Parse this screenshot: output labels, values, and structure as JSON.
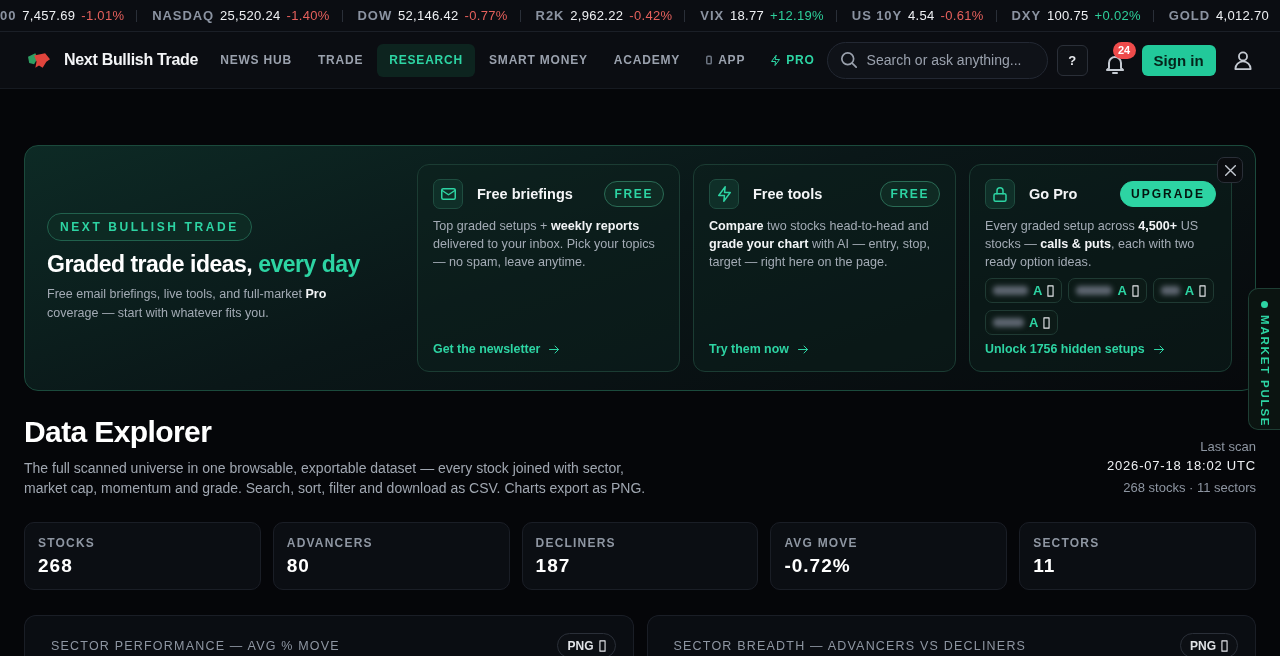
{
  "ticker": [
    {
      "label": "00",
      "value": "7,457.69",
      "change": "-1.01%",
      "positive": false
    },
    {
      "label": "NASDAQ",
      "value": "25,520.24",
      "change": "-1.40%",
      "positive": false
    },
    {
      "label": "DOW",
      "value": "52,146.42",
      "change": "-0.77%",
      "positive": false
    },
    {
      "label": "R2K",
      "value": "2,962.22",
      "change": "-0.42%",
      "positive": false
    },
    {
      "label": "VIX",
      "value": "18.77",
      "change": "+12.19%",
      "positive": true
    },
    {
      "label": "US 10Y",
      "value": "4.54",
      "change": "-0.61%",
      "positive": false
    },
    {
      "label": "DXY",
      "value": "100.75",
      "change": "+0.02%",
      "positive": true
    },
    {
      "label": "GOLD",
      "value": "4,012.70"
    }
  ],
  "nav": {
    "brand": "Next Bullish Trade",
    "items": [
      {
        "label": "NEWS HUB",
        "kind": "plain",
        "selected": false
      },
      {
        "label": "TRADE",
        "kind": "plain",
        "selected": false
      },
      {
        "label": "RESEARCH",
        "kind": "plain",
        "selected": true
      },
      {
        "label": "SMART MONEY",
        "kind": "plain",
        "selected": false
      },
      {
        "label": "ACADEMY",
        "kind": "plain",
        "selected": false
      },
      {
        "label": "APP",
        "kind": "app",
        "selected": false
      },
      {
        "label": "PRO",
        "kind": "pro",
        "selected": false
      }
    ],
    "search": {
      "placeholder": "Search or ask anything..."
    },
    "help_button": "?",
    "notifications": {
      "badge": "24"
    },
    "sign_in": "Sign in"
  },
  "hero": {
    "eyebrow": "NEXT BULLISH TRADE",
    "title": "Graded trade ideas,",
    "title_accent": "every day",
    "subtitle": "Free email briefings, live tools, and full-market **Pro** coverage — start with whatever fits you.",
    "cards": [
      {
        "kind": "mail",
        "title": "Free briefings",
        "badge": {
          "text": "FREE",
          "kind": "outline"
        },
        "text": "Top graded setups + **weekly reports** delivered to your inbox. Pick your topics — no spam, leave anytime.",
        "link": "Get the newsletter"
      },
      {
        "kind": "bolt",
        "title": "Free tools",
        "badge": {
          "text": "FREE",
          "kind": "outline"
        },
        "text": "**Compare** two stocks head-to-head and **grade your chart** with AI — entry, stop, target — right here on the page.",
        "link": "Try them now"
      },
      {
        "kind": "lock",
        "title": "Go Pro",
        "badge": {
          "text": "UPGRADE",
          "kind": "filled"
        },
        "text": "Every graded setup across **4,500+** US stocks — **calls & puts**, each with two ready option ideas.",
        "setups": [
          {
            "grade": "A"
          },
          {
            "grade": "A"
          },
          {
            "grade": "A"
          },
          {
            "grade": "A"
          }
        ],
        "link": "Unlock 1756 hidden setups"
      }
    ]
  },
  "market_pulse": {
    "label": "MARKET PULSE"
  },
  "explorer": {
    "title": "Data Explorer",
    "description": "The full scanned universe in one browsable, exportable dataset — every stock joined with sector, market cap, momentum and grade. Search, sort, filter and download as CSV. Charts export as PNG.",
    "last_scan_label": "Last scan",
    "last_scan": "2026-07-18 18:02 UTC",
    "summary": "268 stocks · 11 sectors",
    "stats": [
      {
        "label": "STOCKS",
        "value": "268"
      },
      {
        "label": "ADVANCERS",
        "value": "80"
      },
      {
        "label": "DECLINERS",
        "value": "187"
      },
      {
        "label": "AVG MOVE",
        "value": "-0.72%"
      },
      {
        "label": "SECTORS",
        "value": "11"
      }
    ],
    "panels": [
      {
        "title": "SECTOR PERFORMANCE — AVG % MOVE",
        "export": "PNG"
      },
      {
        "title": "SECTOR BREADTH — ADVANCERS VS DECLINERS",
        "export": "PNG"
      }
    ]
  }
}
